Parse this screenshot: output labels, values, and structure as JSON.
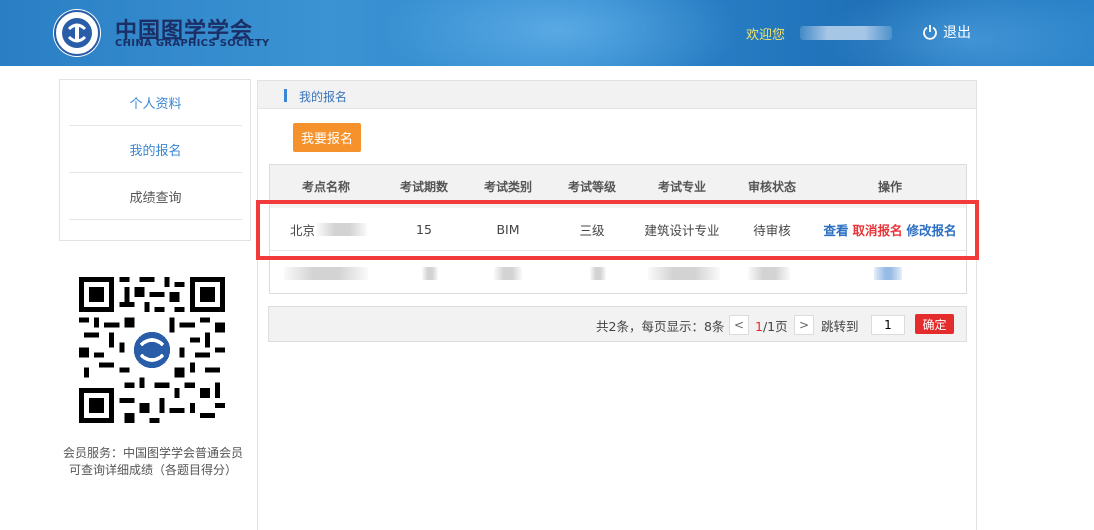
{
  "header": {
    "brand_cn": "中国图学学会",
    "brand_en": "CHINA GRAPHICS SOCIETY",
    "welcome": "欢迎您",
    "logout_label": "退出"
  },
  "sidebar": {
    "items": [
      {
        "label": "个人资料",
        "color": "#3a87d4"
      },
      {
        "label": "我的报名",
        "color": "#3a87d4"
      },
      {
        "label": "成绩查询",
        "color": "#555555"
      }
    ]
  },
  "member_note": "会员服务：中国图学学会普通会员可查询详细成绩（各题目得分）",
  "main": {
    "section_title": "我的报名",
    "register_button": "我要报名",
    "columns": [
      "考点名称",
      "考试期数",
      "考试类别",
      "考试等级",
      "考试专业",
      "审核状态",
      "操作"
    ],
    "rows": [
      {
        "site": "北京",
        "period": "15",
        "category": "BIM",
        "level": "三级",
        "major": "建筑设计专业",
        "status": "待审核",
        "actions": [
          "查看",
          "取消报名",
          "修改报名"
        ]
      }
    ]
  },
  "pager": {
    "summary": "共2条，每页显示：8条",
    "prev": "<",
    "current_page": "1",
    "total_pages": "/1页",
    "next": ">",
    "jump_label": "跳转到",
    "jump_value": "1",
    "confirm": "确定"
  },
  "colors": {
    "accent_blue": "#3a87d4",
    "orange": "#f5922c",
    "red": "#e8353a",
    "welcome_yellow": "#f4e36a"
  }
}
